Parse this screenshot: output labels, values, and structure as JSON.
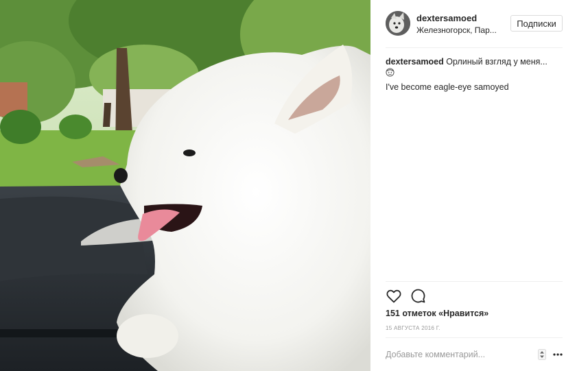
{
  "user": {
    "username": "dextersamoed",
    "location": "Железногорск, Пар...",
    "avatar_icon": "avatar-photo"
  },
  "header": {
    "follow_label": "Подписки"
  },
  "caption": {
    "username": "dextersamoed",
    "text": "Орлиный взгляд у меня...",
    "emoji": "face-emoji",
    "line2": "I've become eagle-eye samoyed"
  },
  "actions": {
    "like_icon": "heart-icon",
    "comment_icon": "comment-icon"
  },
  "likes": "151 отметок «Нравится»",
  "date": "15 АВГУСТА 2016 Г.",
  "comment": {
    "placeholder": "Добавьте комментарий..."
  },
  "colors": {
    "border": "#efefef",
    "text": "#262626",
    "muted": "#999999"
  }
}
